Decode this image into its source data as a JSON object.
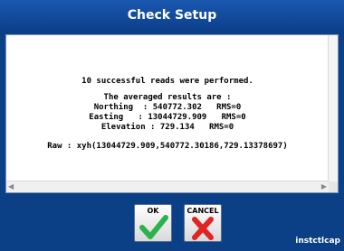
{
  "window": {
    "title": "Check Setup"
  },
  "message": {
    "summary": "10 successful reads were performed.",
    "averaged_header": "The averaged results are :",
    "northing": "Northing  : 540772.302   RMS=0",
    "easting": "Easting   : 13044729.909   RMS=0",
    "elevation": "Elevation : 729.134   RMS=0",
    "raw": "Raw : xyh(13044729.909,540772.30186,729.13378697)"
  },
  "buttons": {
    "ok_label": "OK",
    "cancel_label": "CANCEL",
    "ok_icon": "checkmark-icon",
    "cancel_icon": "x-icon",
    "ok_color": "#2bb24c",
    "cancel_color": "#e02424"
  },
  "watermark": "instctlcap"
}
